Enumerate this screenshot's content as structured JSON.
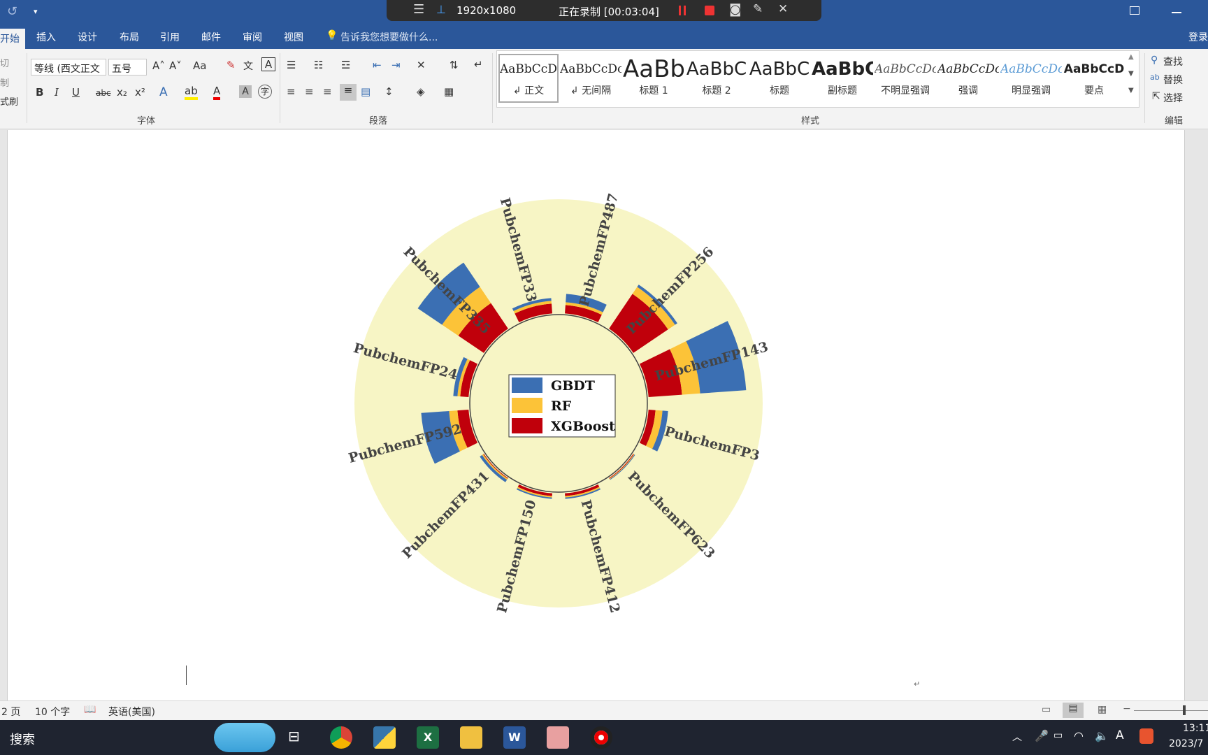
{
  "recorder": {
    "resolution": "1920x1080",
    "status": "正在录制 [00:03:04]"
  },
  "tabs": [
    {
      "label": "开始",
      "active": true
    },
    {
      "label": "插入"
    },
    {
      "label": "设计"
    },
    {
      "label": "布局"
    },
    {
      "label": "引用"
    },
    {
      "label": "邮件"
    },
    {
      "label": "审阅"
    },
    {
      "label": "视图"
    }
  ],
  "tell_me": "告诉我您想要做什么...",
  "login": "登录",
  "clipboard": {
    "cut": "切",
    "copy": "制",
    "format_painter": "式刷"
  },
  "font": {
    "name": "等线 (西文正文",
    "size": "五号",
    "group_label": "字体",
    "bold": "B",
    "italic": "I",
    "underline": "U",
    "strike": "abc",
    "grow": "A˄",
    "shrink": "A˅",
    "case": "Aa",
    "text_style": "A",
    "char_border": "A"
  },
  "paragraph": {
    "group_label": "段落"
  },
  "styles": {
    "group_label": "样式",
    "items": [
      {
        "preview": "AaBbCcDc",
        "name": "↲ 正文"
      },
      {
        "preview": "AaBbCcDc",
        "name": "↲ 无间隔"
      },
      {
        "preview": "AaBb",
        "name": "标题 1"
      },
      {
        "preview": "AaBbC",
        "name": "标题 2"
      },
      {
        "preview": "AaBbC",
        "name": "标题"
      },
      {
        "preview": "AaBbC",
        "name": "副标题"
      },
      {
        "preview": "AaBbCcDc",
        "name": "不明显强调"
      },
      {
        "preview": "AaBbCcDc",
        "name": "强调"
      },
      {
        "preview": "AaBbCcDc",
        "name": "明显强调"
      },
      {
        "preview": "AaBbCcD",
        "name": "要点"
      }
    ]
  },
  "editing": {
    "group_label": "编辑",
    "find": "查找",
    "replace": "替换",
    "select": "选择"
  },
  "status": {
    "page": "2 页",
    "words": "10 个字",
    "language": "英语(美国)"
  },
  "taskbar": {
    "search": "搜索",
    "time": "13:11",
    "date": "2023/7"
  },
  "colors": {
    "ribbon_blue": "#2b579a",
    "gbdt": "#3b6fb3",
    "rf": "#fcc338",
    "xgboost": "#c0000b",
    "chart_bg": "#f7f5c5"
  },
  "chart_data": {
    "type": "bar",
    "subtype": "circular-stacked-bar",
    "categories": [
      "PubchemFP143",
      "PubchemFP3",
      "PubchemFP623",
      "PubchemFP412",
      "PubchemFP150",
      "PubchemFP431",
      "PubchemFP592",
      "PubchemFP24",
      "PubchemFP335",
      "PubchemFP33",
      "PubchemFP487",
      "PubchemFP256"
    ],
    "series": [
      {
        "name": "XGBoost",
        "values": [
          0.24,
          0.05,
          0.005,
          0.02,
          0.02,
          0.005,
          0.08,
          0.06,
          0.22,
          0.07,
          0.06,
          0.3
        ]
      },
      {
        "name": "RF",
        "values": [
          0.13,
          0.05,
          0.005,
          0.01,
          0.01,
          0.01,
          0.06,
          0.02,
          0.14,
          0.02,
          0.02,
          0.06
        ]
      },
      {
        "name": "GBDT",
        "values": [
          0.33,
          0.04,
          0.005,
          0.01,
          0.01,
          0.02,
          0.2,
          0.03,
          0.21,
          0.02,
          0.06,
          0.02
        ]
      }
    ],
    "legend": {
      "position": "center",
      "entries": [
        "GBDT",
        "RF",
        "XGBoost"
      ]
    }
  }
}
